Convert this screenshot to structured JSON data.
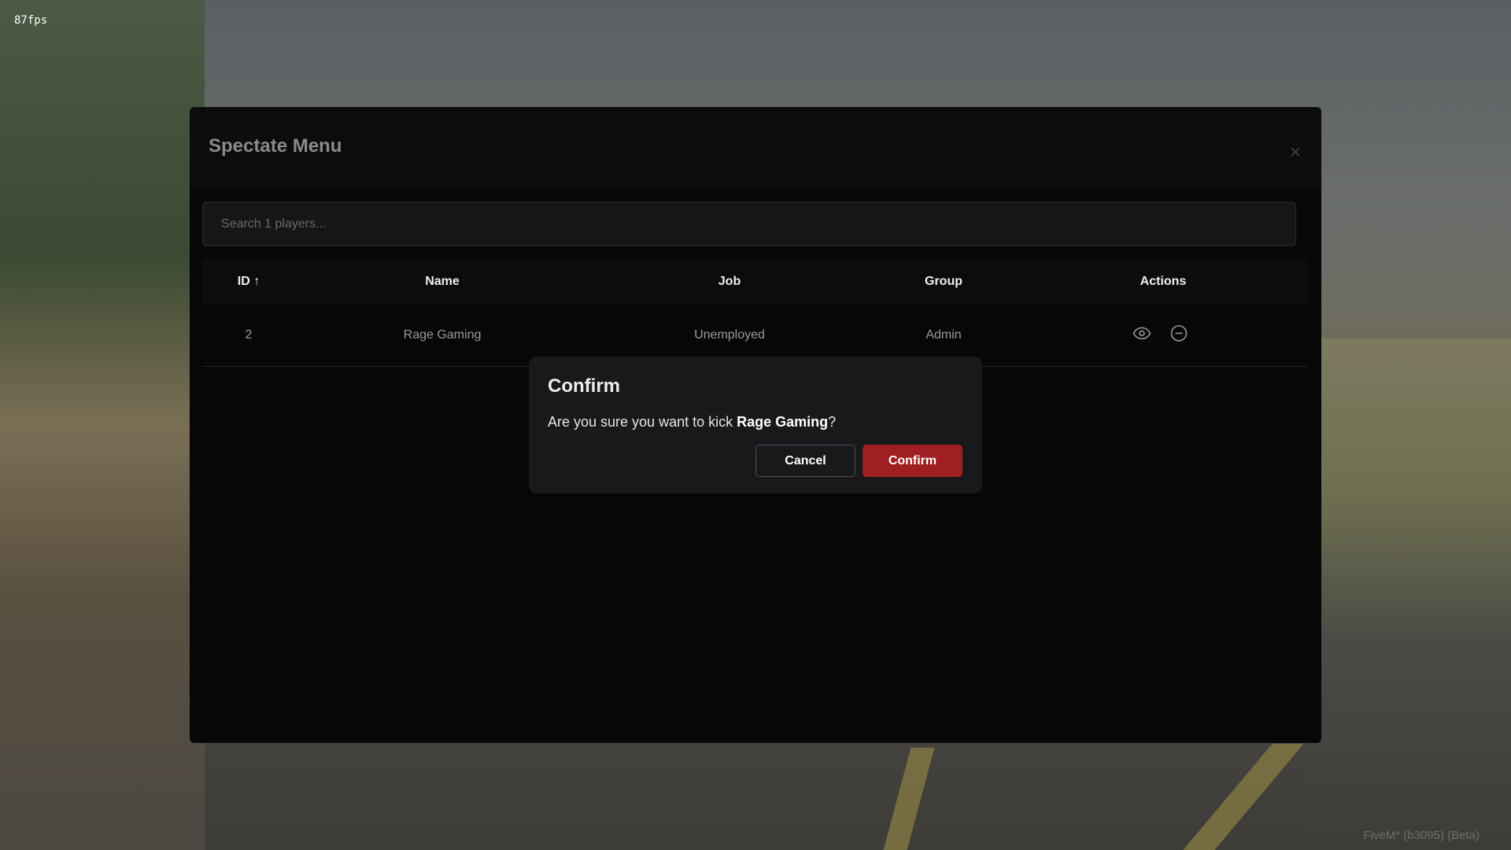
{
  "overlay": {
    "fps": "87fps",
    "build": "FiveM* (b3095) (Beta)"
  },
  "modal": {
    "title": "Spectate Menu",
    "close_label": "×",
    "search": {
      "placeholder": "Search 1 players...",
      "value": ""
    },
    "columns": [
      "ID ↑",
      "Name",
      "Job",
      "Group",
      "Actions"
    ],
    "rows": [
      {
        "id": "2",
        "name": "Rage Gaming",
        "job": "Unemployed",
        "group": "Admin",
        "actions": [
          "eye-icon",
          "minus-circle-icon"
        ]
      }
    ]
  },
  "confirm_dialog": {
    "title": "Confirm",
    "message_prefix": "Are you sure you want to kick ",
    "target": "Rage Gaming",
    "message_suffix": "?",
    "cancel_label": "Cancel",
    "confirm_label": "Confirm",
    "confirm_color": "#a01f22"
  }
}
